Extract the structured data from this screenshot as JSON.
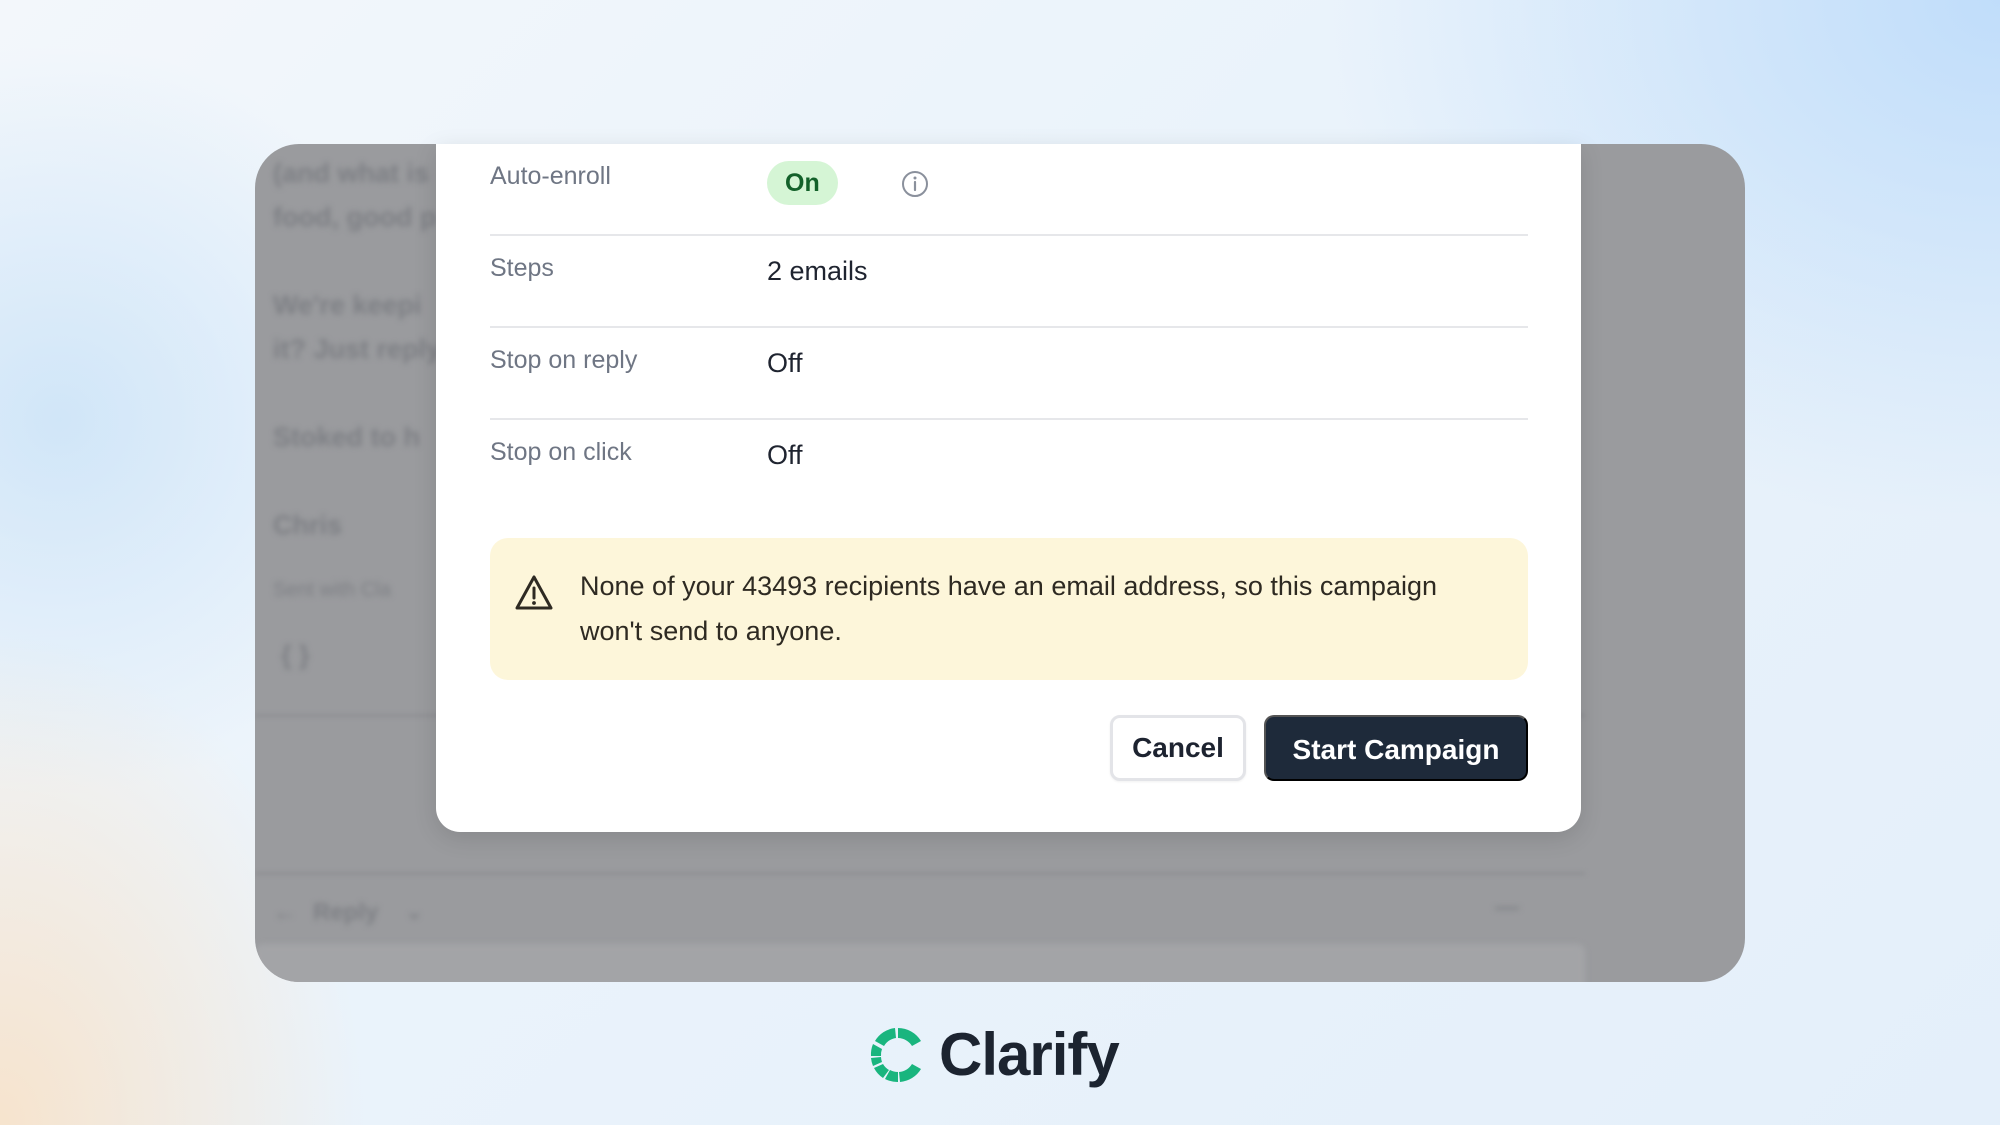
{
  "background_app": {
    "text_lines": [
      "(and what is",
      "food, good p",
      "We're keepi",
      "it? Just reply",
      "Stoked to h",
      "Chris",
      "Sent with Cla",
      "{ }"
    ],
    "reply_label": "Reply"
  },
  "modal": {
    "rows": [
      {
        "label": "Auto-enroll",
        "value": "On"
      },
      {
        "label": "Steps",
        "value": "2 emails"
      },
      {
        "label": "Stop on reply",
        "value": "Off"
      },
      {
        "label": "Stop on click",
        "value": "Off"
      }
    ],
    "warning": {
      "text": "None of your 43493 recipients have an email address, so this campaign won't send to anyone."
    },
    "cancel_label": "Cancel",
    "start_label": "Start Campaign"
  },
  "brand": {
    "name": "Clarify",
    "colors": {
      "mark": "#19b57e",
      "text": "#1c2430"
    }
  },
  "colors": {
    "primary_button": "#1e2a3a",
    "pill_bg": "#d5f5d5",
    "pill_text": "#13612a",
    "warning_bg": "#fdf6da"
  }
}
